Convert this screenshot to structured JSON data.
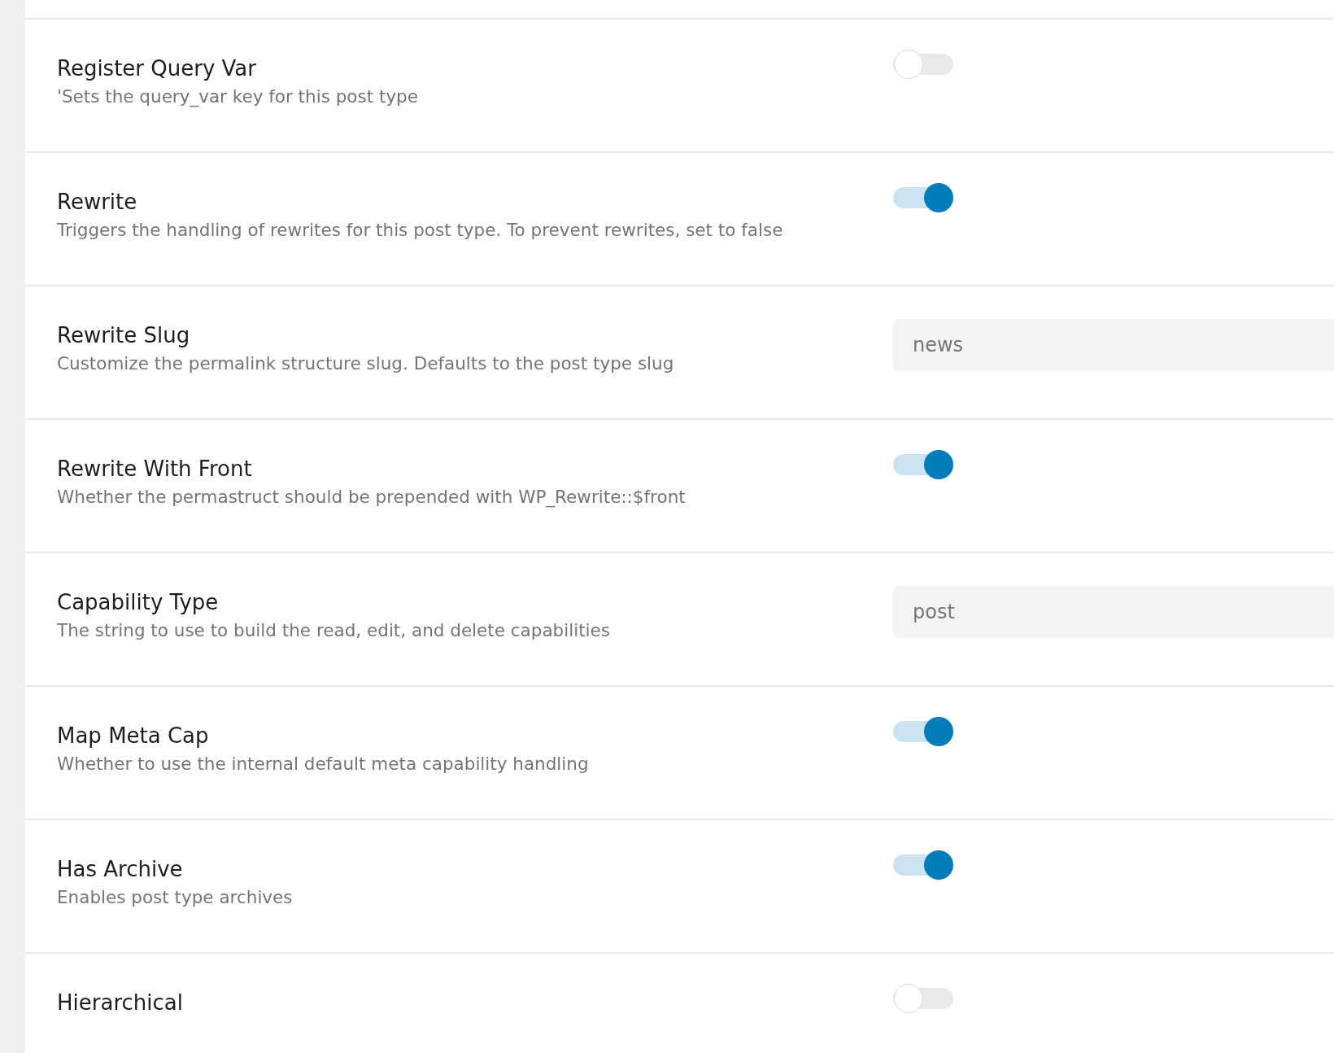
{
  "settings": [
    {
      "label": "Register Query Var",
      "description": "'Sets the query_var key for this post type",
      "kind": "toggle",
      "on": false
    },
    {
      "label": "Rewrite",
      "description": "Triggers the handling of rewrites for this post type. To prevent rewrites, set to false",
      "kind": "toggle",
      "on": true
    },
    {
      "label": "Rewrite Slug",
      "description": "Customize the permalink structure slug. Defaults to the post type slug",
      "kind": "text",
      "value": "news"
    },
    {
      "label": "Rewrite With Front",
      "description": "Whether the permastruct should be prepended with WP_Rewrite::$front",
      "kind": "toggle",
      "on": true
    },
    {
      "label": "Capability Type",
      "description": "The string to use to build the read, edit, and delete capabilities",
      "kind": "text",
      "value": "post"
    },
    {
      "label": "Map Meta Cap",
      "description": "Whether to use the internal default meta capability handling",
      "kind": "toggle",
      "on": true
    },
    {
      "label": "Has Archive",
      "description": "Enables post type archives",
      "kind": "toggle",
      "on": true
    },
    {
      "label": "Hierarchical",
      "kind": "toggle",
      "on": false
    }
  ]
}
